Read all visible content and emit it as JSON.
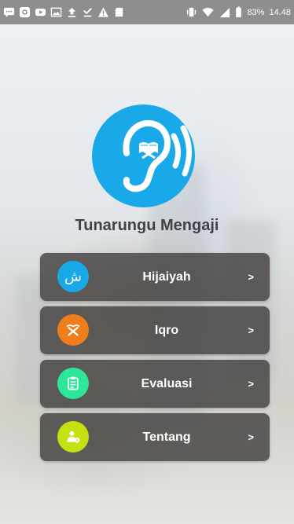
{
  "status_bar": {
    "battery": "83%",
    "time": "14.48",
    "left_icons": [
      "message-icon",
      "camera-icon",
      "youtube-icon",
      "image-icon",
      "upload-icon",
      "download-done-icon",
      "warning-icon",
      "sd-card-icon"
    ],
    "right_icons": [
      "vibrate-icon",
      "wifi-icon",
      "signal-icon",
      "battery-icon"
    ]
  },
  "app": {
    "title": "Tunarungu Mengaji",
    "logo_color": "#1aa9e8"
  },
  "menu": {
    "items": [
      {
        "label": "Hijaiyah",
        "arrow": ">",
        "icon": "arabic-letter-icon",
        "icon_glyph": "ش",
        "color": "#1aa9e8"
      },
      {
        "label": "Iqro",
        "arrow": ">",
        "icon": "quran-stand-icon",
        "color": "#ee7d1b"
      },
      {
        "label": "Evaluasi",
        "arrow": ">",
        "icon": "clipboard-icon",
        "color": "#2ee69a"
      },
      {
        "label": "Tentang",
        "arrow": ">",
        "icon": "person-info-icon",
        "color": "#c7e00f"
      }
    ]
  }
}
